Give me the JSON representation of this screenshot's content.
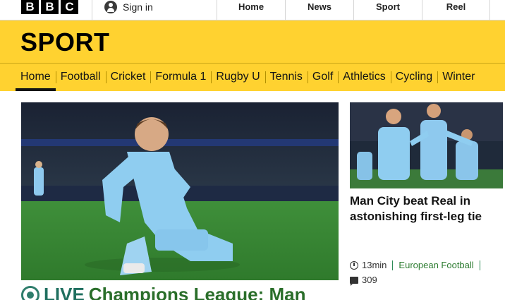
{
  "header": {
    "logo": "BBC",
    "logo_letters": [
      "B",
      "B",
      "C"
    ],
    "signin_label": "Sign in",
    "global_nav": [
      "Home",
      "News",
      "Sport",
      "Reel"
    ]
  },
  "sport": {
    "title": "SPORT",
    "nav": [
      "Home",
      "Football",
      "Cricket",
      "Formula 1",
      "Rugby U",
      "Tennis",
      "Golf",
      "Athletics",
      "Cycling",
      "Winter"
    ],
    "active_nav": "Home"
  },
  "hero": {
    "image_alt": "Footballer in light blue kit sliding on knees celebrating",
    "live_label": "LIVE",
    "title": "Champions League: Man"
  },
  "side_story": {
    "title": "Man City beat Real in astonishing first-leg tie",
    "time": "13min",
    "section": "European Football",
    "comments": "309"
  },
  "colors": {
    "sport_yellow": "#ffd230",
    "live_green": "#1f6f5f",
    "section_green": "#2e7d32"
  }
}
